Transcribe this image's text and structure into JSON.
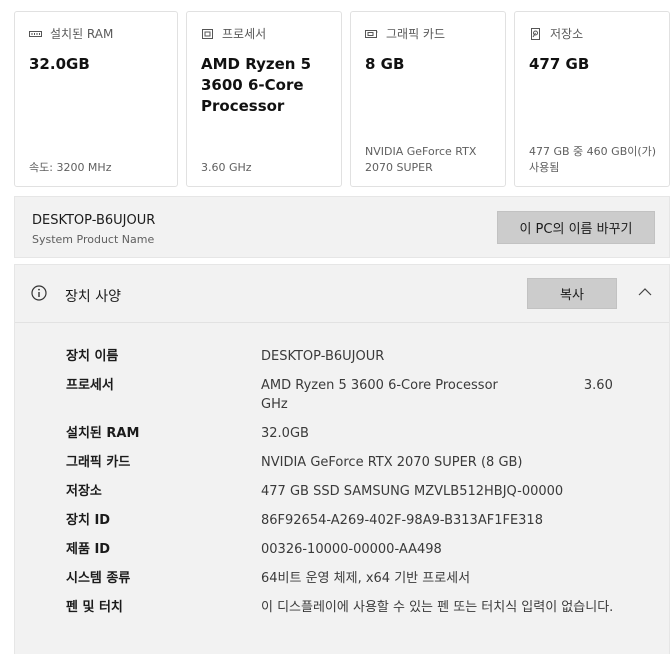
{
  "cards": [
    {
      "label": "설치된 RAM",
      "icon": "ram-icon",
      "value": "32.0GB",
      "sub": "속도: 3200 MHz"
    },
    {
      "label": "프로세서",
      "icon": "processor-icon",
      "value": "AMD Ryzen 5 3600 6-Core Processor",
      "sub": "3.60 GHz"
    },
    {
      "label": "그래픽 카드",
      "icon": "graphics-card-icon",
      "value": "8 GB",
      "sub": "NVIDIA GeForce RTX 2070 SUPER"
    },
    {
      "label": "저장소",
      "icon": "storage-icon",
      "value": "477 GB",
      "sub": "477 GB 중 460 GB이(가) 사용됨"
    }
  ],
  "device": {
    "name": "DESKTOP-B6UJOUR",
    "sub": "System Product Name",
    "rename_label": "이 PC의 이름 바꾸기"
  },
  "specs": {
    "title": "장치 사양",
    "copy_label": "복사",
    "rows": [
      {
        "label": "장치 이름",
        "value": "DESKTOP-B6UJOUR"
      },
      {
        "label": "프로세서",
        "value": "AMD Ryzen 5 3600 6-Core Processor",
        "value_extra": "3.60",
        "value_tail": "GHz"
      },
      {
        "label": "설치된 RAM",
        "value": "32.0GB"
      },
      {
        "label": "그래픽 카드",
        "value": "NVIDIA GeForce RTX 2070 SUPER (8 GB)"
      },
      {
        "label": "저장소",
        "value": "477 GB SSD SAMSUNG MZVLB512HBJQ-00000"
      },
      {
        "label": "장치 ID",
        "value": "86F92654-A269-402F-98A9-B313AF1FE318"
      },
      {
        "label": "제품 ID",
        "value": "00326-10000-00000-AA498"
      },
      {
        "label": "시스템 종류",
        "value": "64비트 운영 체제, x64 기반 프로세서"
      },
      {
        "label": "펜 및 터치",
        "value": "이 디스플레이에 사용할 수 있는 펜 또는 터치식 입력이 없습니다."
      }
    ]
  }
}
